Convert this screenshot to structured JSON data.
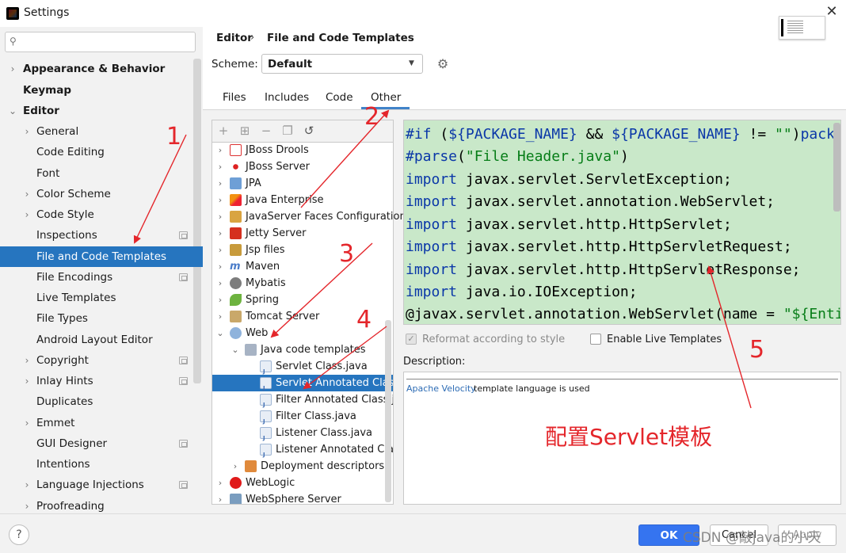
{
  "window": {
    "title": "Settings"
  },
  "search": {
    "placeholder": ""
  },
  "sidebar": {
    "items": [
      {
        "label": "Appearance & Behavior"
      },
      {
        "label": "Keymap"
      },
      {
        "label": "Editor"
      },
      {
        "label": "General"
      },
      {
        "label": "Code Editing"
      },
      {
        "label": "Font"
      },
      {
        "label": "Color Scheme"
      },
      {
        "label": "Code Style"
      },
      {
        "label": "Inspections"
      },
      {
        "label": "File and Code Templates"
      },
      {
        "label": "File Encodings"
      },
      {
        "label": "Live Templates"
      },
      {
        "label": "File Types"
      },
      {
        "label": "Android Layout Editor"
      },
      {
        "label": "Copyright"
      },
      {
        "label": "Inlay Hints"
      },
      {
        "label": "Duplicates"
      },
      {
        "label": "Emmet"
      },
      {
        "label": "GUI Designer"
      },
      {
        "label": "Intentions"
      },
      {
        "label": "Language Injections"
      },
      {
        "label": "Proofreading"
      }
    ]
  },
  "header": {
    "section": "Editor",
    "separator": "›",
    "page": "File and Code Templates"
  },
  "scheme": {
    "label": "Scheme:",
    "value": "Default"
  },
  "tabs": [
    {
      "label": "Files"
    },
    {
      "label": "Includes"
    },
    {
      "label": "Code"
    },
    {
      "label": "Other"
    }
  ],
  "tree": {
    "items": [
      {
        "label": "JBoss Drools"
      },
      {
        "label": "JBoss Server"
      },
      {
        "label": "JPA"
      },
      {
        "label": "Java Enterprise"
      },
      {
        "label": "JavaServer Faces Configuration"
      },
      {
        "label": "Jetty Server"
      },
      {
        "label": "Jsp files"
      },
      {
        "label": "Maven"
      },
      {
        "label": "Mybatis"
      },
      {
        "label": "Spring"
      },
      {
        "label": "Tomcat Server"
      },
      {
        "label": "Web"
      },
      {
        "label": "Java code templates"
      },
      {
        "label": "Servlet Class.java"
      },
      {
        "label": "Servlet Annotated Class.java"
      },
      {
        "label": "Filter Annotated Class.java"
      },
      {
        "label": "Filter Class.java"
      },
      {
        "label": "Listener Class.java"
      },
      {
        "label": "Listener Annotated Class"
      },
      {
        "label": "Deployment descriptors"
      },
      {
        "label": "WebLogic"
      },
      {
        "label": "WebSphere Server"
      }
    ]
  },
  "code": {
    "lines": [
      [
        "#if",
        " (",
        "${PACKAGE_NAME}",
        " && ",
        "${PACKAGE_NAME}",
        " != ",
        "\"\"",
        ")",
        "package"
      ],
      [
        "#parse",
        "(",
        "\"File Header.java\"",
        ")"
      ],
      [
        "import",
        " javax.servlet.ServletException;"
      ],
      [
        "import",
        " javax.servlet.annotation.WebServlet;"
      ],
      [
        "import",
        " javax.servlet.http.HttpServlet;"
      ],
      [
        "import",
        " javax.servlet.http.HttpServletRequest;"
      ],
      [
        "import",
        " javax.servlet.http.HttpServletResponse;"
      ],
      [
        "import",
        " java.io.IOException;"
      ],
      [
        "@javax.servlet.annotation.WebServlet(name = ",
        "\"${Entity_Name}\""
      ]
    ]
  },
  "options": {
    "reformat": "Reformat according to style",
    "live_templates": "Enable Live Templates"
  },
  "description": {
    "label": "Description:",
    "link": "Apache Velocity",
    "text": "template language is used"
  },
  "annotations": {
    "n1": "1",
    "n2": "2",
    "n3": "3",
    "n4": "4",
    "n5": "5",
    "caption": "配置Servlet模板"
  },
  "footer": {
    "help": "?",
    "ok": "OK",
    "cancel": "Cancel",
    "apply": "Apply",
    "watermark": "CSDN @敲java的小天"
  },
  "colors": {
    "selection": "#2675bf",
    "editor_bg": "#c9e8c9",
    "keyword": "#0a37a8",
    "string": "#067d17",
    "annotation": "#e4262b",
    "ok_button": "#3574f0"
  }
}
